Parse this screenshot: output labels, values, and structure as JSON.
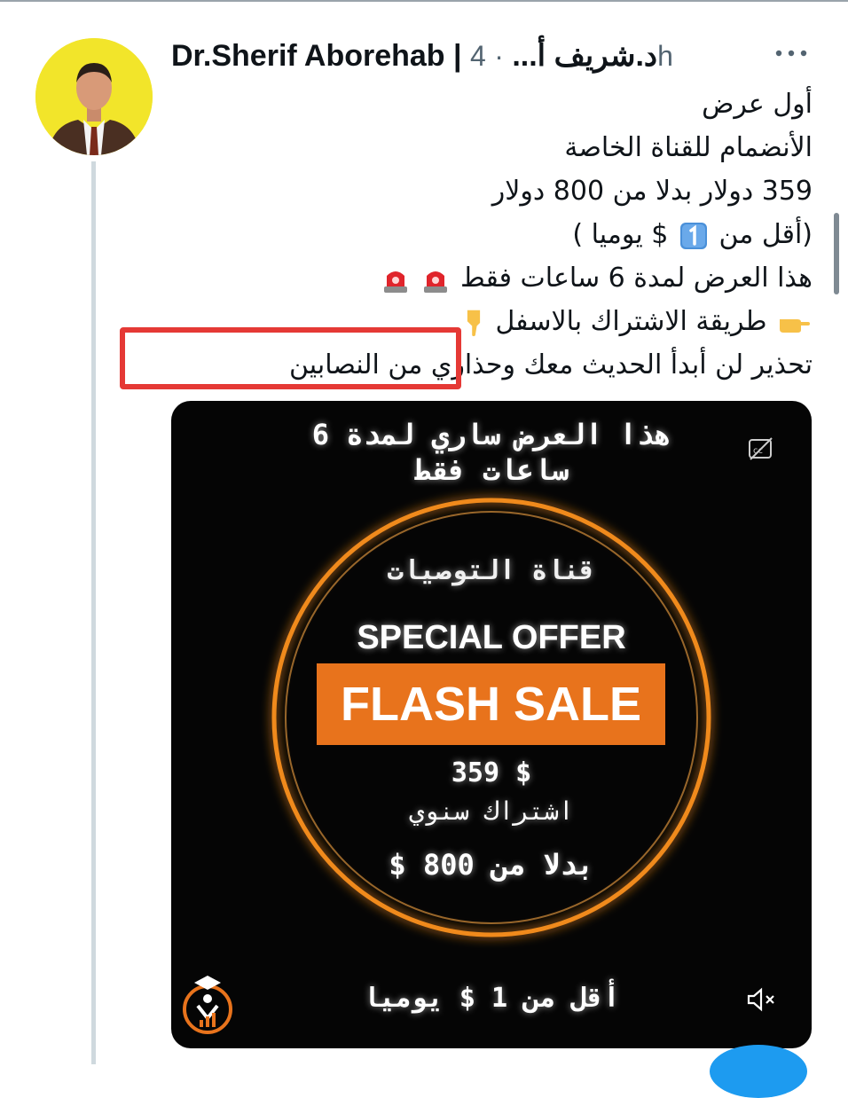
{
  "post": {
    "author_display": "Dr.Sherif Aborehab | د.شريف أ...",
    "separator": "·",
    "time": "4h",
    "more": "•••",
    "lines": [
      "أول عرض",
      "الأنضمام للقناة الخاصة",
      "359 دولار بدلا من 800 دولار",
      "(أقل من",
      "$ يوميا )",
      "هذا العرض لمدة 6 ساعات فقط",
      "طريقة الاشتراك بالاسفل",
      "تحذير لن أبدأ الحديث معك",
      "وحذاري من النصابين"
    ]
  },
  "media": {
    "header_line1": "هذا العرض ساري لمدة 6",
    "header_line2": "ساعات فقط",
    "channel": "قناة التوصيات",
    "special": "SPECIAL OFFER",
    "flash": "FLASH SALE",
    "price": "359 $",
    "annual": "اشتراك سنوي",
    "instead": "بدلا من 800 $",
    "daily": "أقل من 1 $ يوميا"
  },
  "colors": {
    "ring": "#f08a1e",
    "flash_bg": "#e8731c",
    "highlight": "#e53935",
    "avatar_bg": "#f2e52a"
  },
  "icons": {
    "cc": "closed-captions-icon",
    "mute": "speaker-muted-icon",
    "more": "more-options-icon"
  }
}
